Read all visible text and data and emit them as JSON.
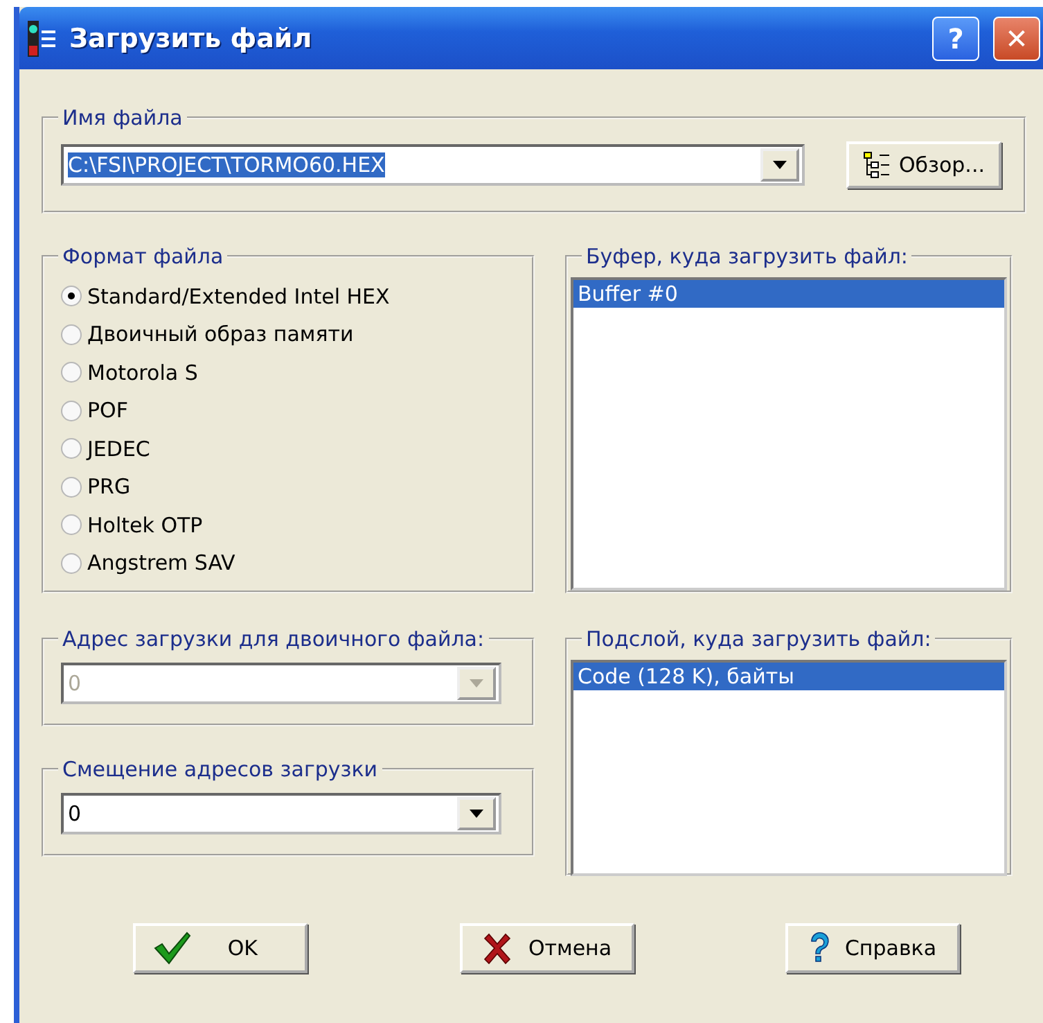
{
  "window": {
    "title": "Загрузить файл",
    "buttons": [
      {
        "kind": "help",
        "label": "?"
      },
      {
        "kind": "close",
        "label": "✕"
      }
    ]
  },
  "file_name": {
    "label": "Имя файла",
    "value": "C:\\FSI\\PROJECT\\TORMO60.HEX",
    "value_selected": true,
    "browse_button": "Обзор..."
  },
  "file_format": {
    "label": "Формат файла",
    "options": [
      {
        "label": "Standard/Extended Intel HEX",
        "selected": true
      },
      {
        "label": "Двоичный образ памяти",
        "selected": false
      },
      {
        "label": "Motorola S",
        "selected": false
      },
      {
        "label": "POF",
        "selected": false
      },
      {
        "label": "JEDEC",
        "selected": false
      },
      {
        "label": "PRG",
        "selected": false
      },
      {
        "label": "Holtek OTP",
        "selected": false
      },
      {
        "label": "Angstrem SAV",
        "selected": false
      }
    ]
  },
  "buffer": {
    "label": "Буфер, куда загрузить файл:",
    "items": [
      {
        "label": "Buffer #0",
        "selected": true
      }
    ]
  },
  "binary_address": {
    "label": "Адрес загрузки для двоичного файла:",
    "value": "0",
    "disabled": true
  },
  "address_offset": {
    "label": "Смещение адресов загрузки",
    "value": "0",
    "disabled": false
  },
  "sublayer": {
    "label": "Подслой, куда загрузить файл:",
    "items": [
      {
        "label": "Code (128 K), байты",
        "selected": true
      }
    ]
  },
  "buttons": [
    {
      "kind": "ok",
      "label": "OK"
    },
    {
      "kind": "cancel",
      "label": "Отмена"
    },
    {
      "kind": "help",
      "label": "Справка"
    }
  ]
}
